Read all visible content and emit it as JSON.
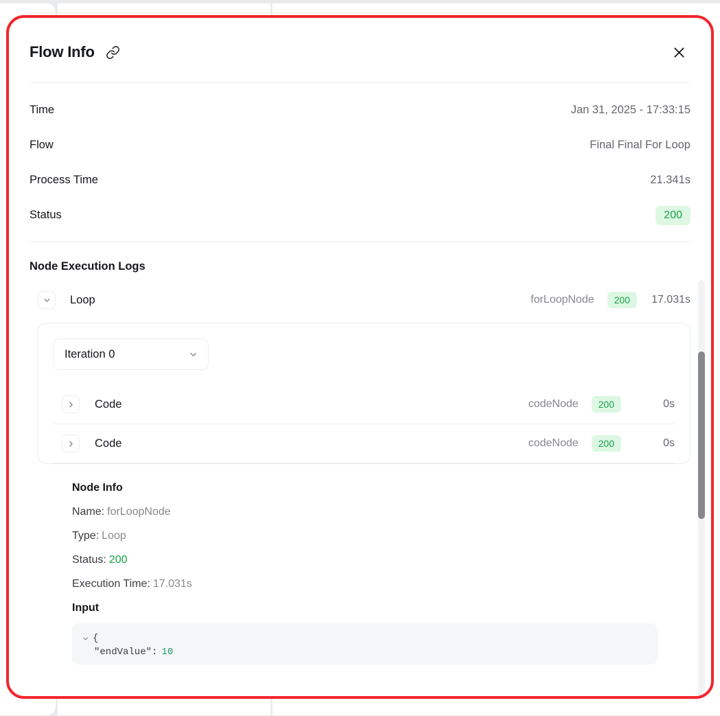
{
  "modal": {
    "title": "Flow Info",
    "link_icon": "link-icon",
    "close_icon": "close-icon"
  },
  "info_rows": [
    {
      "label": "Time",
      "value": "Jan 31, 2025 - 17:33:15",
      "type": "text"
    },
    {
      "label": "Flow",
      "value": "Final Final For Loop",
      "type": "text"
    },
    {
      "label": "Process Time",
      "value": "21.341s",
      "type": "text"
    },
    {
      "label": "Status",
      "value": "200",
      "type": "badge"
    }
  ],
  "logs": {
    "heading": "Node Execution Logs",
    "root_node": {
      "chevron": "chevron-down-icon",
      "name": "Loop",
      "type": "forLoopNode",
      "status": "200",
      "time": "17.031s"
    },
    "iteration": {
      "selected": "Iteration 0",
      "chevron": "chevron-down-icon"
    },
    "child_nodes": [
      {
        "chevron": "chevron-right-icon",
        "name": "Code",
        "type": "codeNode",
        "status": "200",
        "time": "0s"
      },
      {
        "chevron": "chevron-right-icon",
        "name": "Code",
        "type": "codeNode",
        "status": "200",
        "time": "0s"
      }
    ]
  },
  "node_info": {
    "title": "Node Info",
    "fields": [
      {
        "label": "Name:",
        "value": "forLoopNode",
        "green": false
      },
      {
        "label": "Type:",
        "value": "Loop",
        "green": false
      },
      {
        "label": "Status:",
        "value": "200",
        "green": true
      },
      {
        "label": "Execution Time:",
        "value": "17.031s",
        "green": false
      }
    ],
    "input_title": "Input",
    "input_json": {
      "chevron": "chevron-down-icon",
      "brace": "{",
      "key": "\"endValue\":",
      "value": "10"
    }
  },
  "scrollbar": {
    "name": "vertical-scrollbar"
  },
  "colors": {
    "accent_green": "#17a34a",
    "badge_bg": "#ddf7e3",
    "annotation_red": "#f4252b",
    "muted_text": "#86878d"
  }
}
